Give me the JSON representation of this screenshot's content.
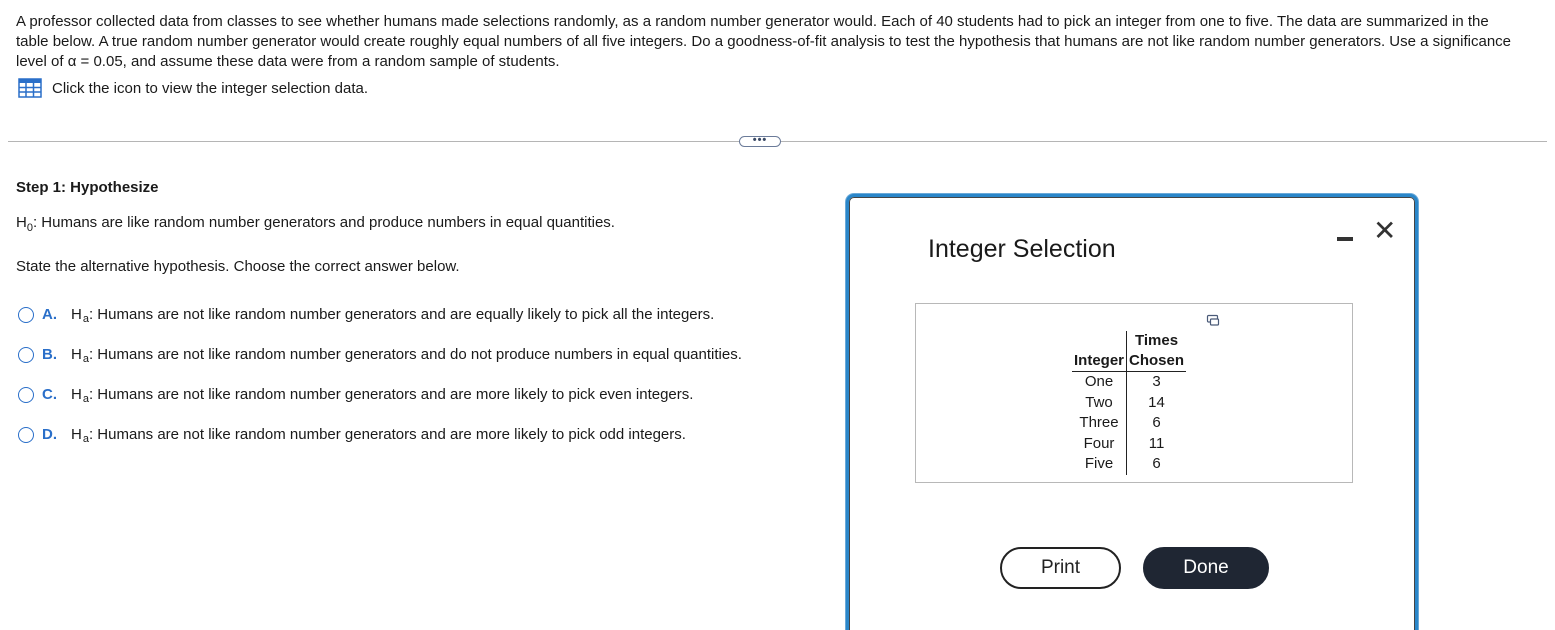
{
  "question": {
    "text": "A professor collected data from classes to see whether humans made selections randomly, as a random number generator would. Each of 40 students had to pick an integer from one to five. The data are summarized in the table below. A true random number generator would create roughly equal numbers of all five integers. Do a goodness-of-fit analysis to test the hypothesis that humans are not like random number generators. Use a significance level of α = 0.05, and assume these data were from a random sample of students.",
    "data_link": "Click the icon to view the integer selection data.",
    "data_icon": "table-grid-icon"
  },
  "expand_button": "•••",
  "step": {
    "title": "Step 1: Hypothesize",
    "h0_letter": "H",
    "h0_sub": "0",
    "h0_text": ": Humans are like random number generators and produce numbers in equal quantities.",
    "instruction": "State the alternative hypothesis. Choose the correct answer below."
  },
  "choices": [
    {
      "letter": "A.",
      "h": "H",
      "sub": "a",
      "text": ": Humans are not like random number generators and are equally likely to pick all the integers."
    },
    {
      "letter": "B.",
      "h": "H",
      "sub": "a",
      "text": ": Humans are not like random number generators and do not produce numbers in equal quantities."
    },
    {
      "letter": "C.",
      "h": "H",
      "sub": "a",
      "text": ": Humans are not like random number generators and are more likely to pick even integers."
    },
    {
      "letter": "D.",
      "h": "H",
      "sub": "a",
      "text": ": Humans are not like random number generators and are more likely to pick odd integers."
    }
  ],
  "dialog": {
    "title": "Integer Selection",
    "table": {
      "header_top": "Times",
      "col1": "Integer",
      "col2": "Chosen",
      "rows": [
        {
          "integer": "One",
          "chosen": "3"
        },
        {
          "integer": "Two",
          "chosen": "14"
        },
        {
          "integer": "Three",
          "chosen": "6"
        },
        {
          "integer": "Four",
          "chosen": "11"
        },
        {
          "integer": "Five",
          "chosen": "6"
        }
      ]
    },
    "print_label": "Print",
    "done_label": "Done"
  },
  "colors": {
    "accent": "#2a6fc9",
    "dialog_border": "#2a86c9",
    "done_bg": "#1f2633"
  }
}
